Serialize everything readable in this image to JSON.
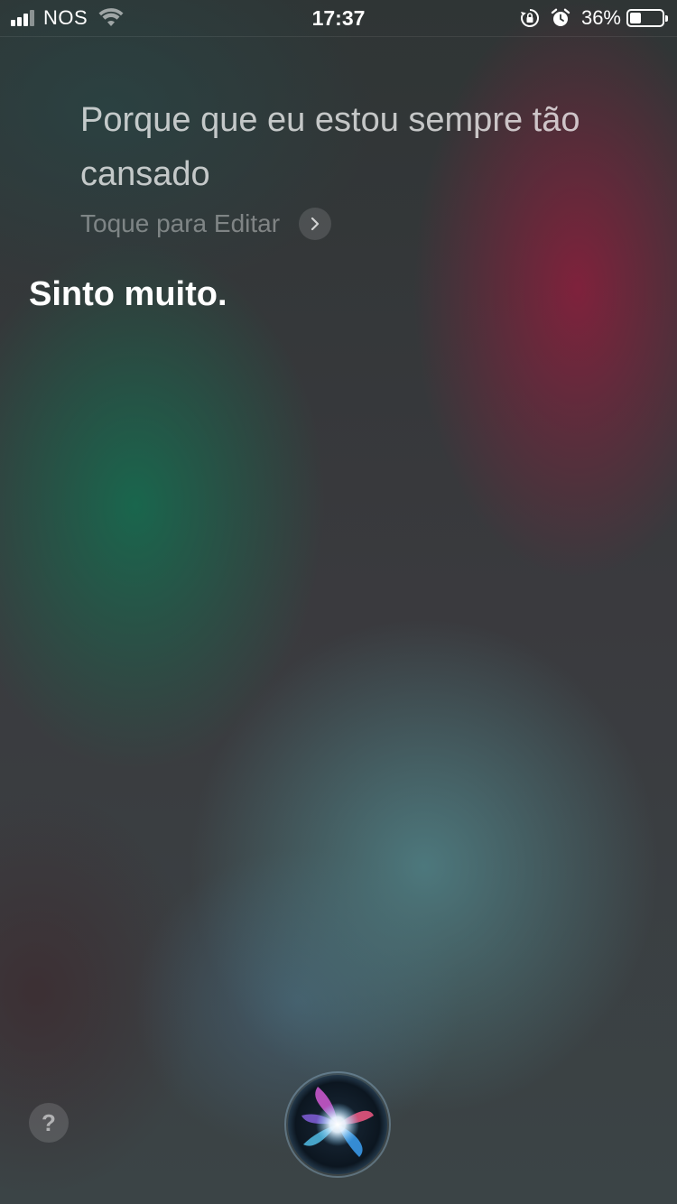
{
  "status_bar": {
    "carrier": "NOS",
    "time": "17:37",
    "battery_percent": "36%",
    "battery_level": 0.36,
    "signal_bars_active": 3,
    "signal_bars_total": 4,
    "icons": [
      "signal-icon",
      "wifi-icon",
      "orientation-lock-icon",
      "alarm-icon",
      "battery-icon"
    ]
  },
  "siri": {
    "query_text": "Porque que eu estou sempre tão cansado",
    "edit_hint": "Toque para Editar",
    "response_text": "Sinto muito.",
    "help_label": "?"
  },
  "colors": {
    "text_primary": "#ffffff",
    "query_text": "rgba(255,255,255,0.72)",
    "hint_text": "rgba(255,255,255,0.38)"
  }
}
